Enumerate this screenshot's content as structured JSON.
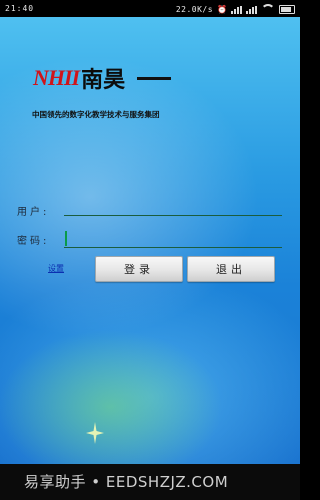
{
  "status_bar": {
    "time": "21:40",
    "net_speed": "22.0K/s"
  },
  "header": {
    "logo_mark": "NHII",
    "logo_name": "南昊",
    "slogan": "中国领先的数字化教学技术与服务集团"
  },
  "form": {
    "user_label": "用户:",
    "user_value": "",
    "password_label": "密码:",
    "password_value": ""
  },
  "links": {
    "settings": "设置"
  },
  "buttons": {
    "login": "登录",
    "exit": "退出"
  },
  "watermark": {
    "text": "易享助手 • EEDSHZJZ.COM",
    "sub": "易享助手"
  },
  "colors": {
    "logo_red": "#d0141a",
    "background_blue": "#2a9be2",
    "link_blue": "#0b2fb0"
  }
}
